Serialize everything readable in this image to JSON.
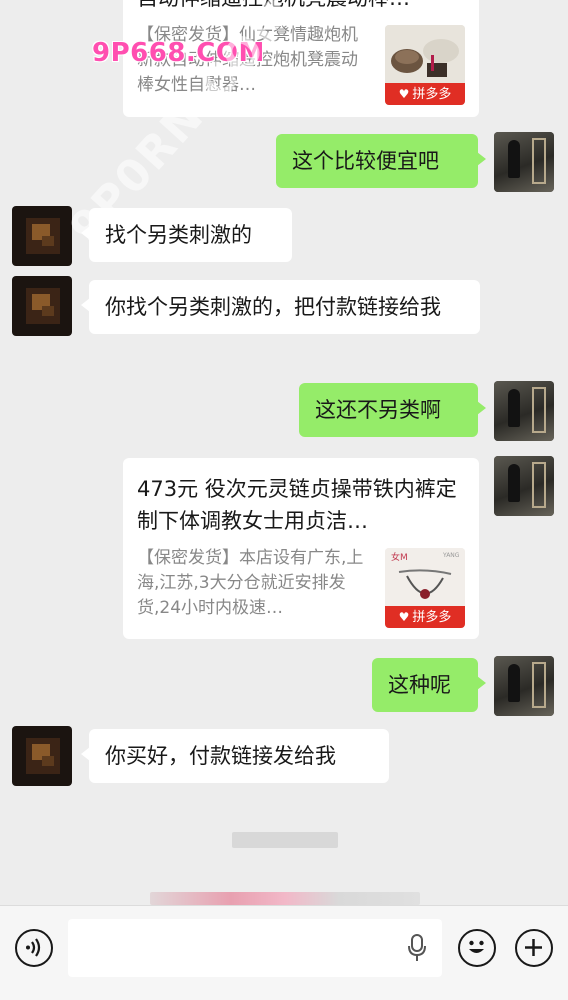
{
  "watermark": "9P668.COM",
  "watermark_diagonal": "9P0RN.COM",
  "messages": [
    {
      "title": "自动伸缩遥控炮机凳震动棒…",
      "desc": "【保密发货】仙女凳情趣炮机新款自动伸缩遥控炮机凳震动棒女性自慰器…",
      "badge": "拼多多"
    },
    {
      "text": "这个比较便宜吧"
    },
    {
      "text": "找个另类刺激的"
    },
    {
      "text": "你找个另类刺激的，把付款链接给我"
    },
    {
      "text": "这还不另类啊"
    },
    {
      "title": "473元 役次元灵链贞操带铁内裤定制下体调教女士用贞洁…",
      "desc": "【保密发货】本店设有广东,上海,江苏,3大分仓就近安排发货,24小时内极速…",
      "badge": "拼多多"
    },
    {
      "text": "这种呢"
    },
    {
      "text": "你买好，付款链接发给我"
    }
  ],
  "toolbar": {
    "voice_icon": "voice-icon",
    "mic_icon": "mic-icon",
    "emoji_icon": "emoji-icon",
    "add_icon": "add-icon"
  }
}
